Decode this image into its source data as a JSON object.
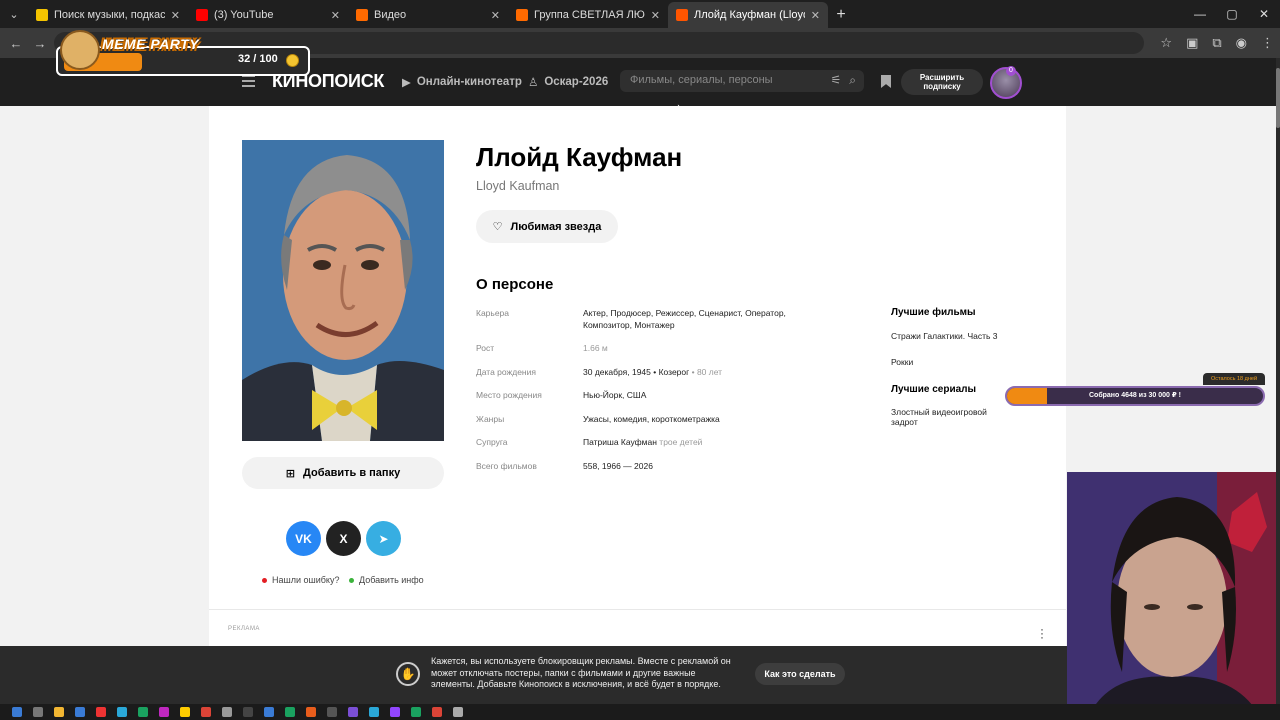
{
  "browser": {
    "tabs": [
      {
        "title": "Поиск музыки, подкастов и аудиокниг",
        "favicon_color": "#f5c400",
        "active": false
      },
      {
        "title": "(3) YouTube",
        "favicon_color": "#ff0000",
        "active": false
      },
      {
        "title": "Видео",
        "favicon_color": "#ff6a00",
        "active": false
      },
      {
        "title": "Группа СВЕТЛАЯ ЛЮБОВЬ",
        "favicon_color": "#ff6a00",
        "active": false
      },
      {
        "title": "Ллойд Кауфман (Lloyd Kaufman)",
        "favicon_color": "#ff5500",
        "active": true
      }
    ]
  },
  "overlay": {
    "meme_title": "MEME PARTY",
    "meme_count": "32 / 100",
    "meme_progress": 0.32,
    "donate_left": "Осталось 18 дней",
    "donate_text": "Собрано 4648  из 30 000 ₽ !",
    "donate_progress": 0.155
  },
  "header": {
    "logo": "КИНОПОИСК",
    "nav_online": "Онлайн-кинотеатр",
    "nav_oscar": "Оскар-2026",
    "search_placeholder": "Фильмы, сериалы, персоны",
    "subscribe": "Расширить подписку",
    "avatar_badge": "0"
  },
  "person": {
    "name": "Ллойд Кауфман",
    "original_name": "Lloyd Kaufman",
    "favorite_button": "Любимая звезда",
    "folder_button": "Добавить в папку",
    "about_title": "О персоне",
    "facts": [
      {
        "label": "Карьера",
        "value": "Актер, Продюсер, Режиссер, Сценарист, Оператор, Композитор, Монтажер",
        "muted": ""
      },
      {
        "label": "Рост",
        "value": "",
        "muted": "1.66 м"
      },
      {
        "label": "Дата рождения",
        "value": "30 декабря, 1945 • Козерог",
        "muted": " • 80 лет"
      },
      {
        "label": "Место рождения",
        "value": "Нью-Йорк, США",
        "muted": ""
      },
      {
        "label": "Жанры",
        "value": "Ужасы, комедия, короткометражка",
        "muted": ""
      },
      {
        "label": "Супруга",
        "value": "Патриша Кауфман",
        "muted": " трое детей"
      },
      {
        "label": "Всего фильмов",
        "value": "558, 1966 — 2026",
        "muted": ""
      }
    ],
    "best_films_title": "Лучшие фильмы",
    "best_films": [
      "Стражи Галактики. Часть 3",
      "Рокки"
    ],
    "best_series_title": "Лучшие сериалы",
    "best_series": [
      "Злостный видеоигровой задрот"
    ],
    "share": {
      "vk": "VK",
      "x": "X",
      "telegram": "➤"
    },
    "report_error": "Нашли ошибку?",
    "add_info": "Добавить инфо"
  },
  "ad": {
    "label": "РЕКЛАМА",
    "adblock_text": "Кажется, вы используете блокировщик рекламы. Вместе с рекламой он может отключать постеры, папки с фильмами и другие важные элементы. Добавьте Кинопоиск в исключения, и всё будет в порядке.",
    "adblock_button": "Как это сделать"
  },
  "colors": {
    "vk": "#2787f5",
    "x": "#222222",
    "telegram": "#37aee2",
    "accent_orange": "#f08a12",
    "error_dot": "#e31e24",
    "info_dot": "#3bb33b"
  }
}
